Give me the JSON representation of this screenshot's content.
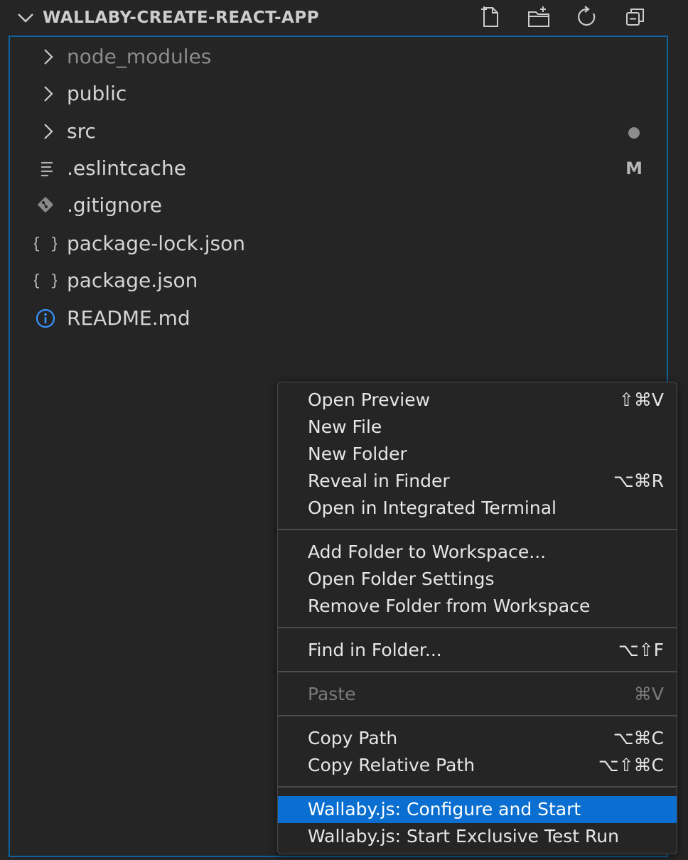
{
  "explorer": {
    "title": "WALLABY-CREATE-REACT-APP",
    "actions": [
      {
        "name": "new-file-icon"
      },
      {
        "name": "new-folder-icon"
      },
      {
        "name": "refresh-icon"
      },
      {
        "name": "collapse-all-icon"
      }
    ],
    "items": [
      {
        "label": "node_modules",
        "type": "folder",
        "dim": true
      },
      {
        "label": "public",
        "type": "folder"
      },
      {
        "label": "src",
        "type": "folder",
        "decoration": "dot"
      },
      {
        "label": ".eslintcache",
        "type": "file-lines",
        "decoration": "M"
      },
      {
        "label": ".gitignore",
        "type": "git"
      },
      {
        "label": "package-lock.json",
        "type": "json"
      },
      {
        "label": "package.json",
        "type": "json"
      },
      {
        "label": "README.md",
        "type": "info"
      }
    ]
  },
  "context_menu": {
    "groups": [
      [
        {
          "label": "Open Preview",
          "shortcut": "⇧⌘V"
        },
        {
          "label": "New File",
          "shortcut": ""
        },
        {
          "label": "New Folder",
          "shortcut": ""
        },
        {
          "label": "Reveal in Finder",
          "shortcut": "⌥⌘R"
        },
        {
          "label": "Open in Integrated Terminal",
          "shortcut": ""
        }
      ],
      [
        {
          "label": "Add Folder to Workspace...",
          "shortcut": ""
        },
        {
          "label": "Open Folder Settings",
          "shortcut": ""
        },
        {
          "label": "Remove Folder from Workspace",
          "shortcut": ""
        }
      ],
      [
        {
          "label": "Find in Folder...",
          "shortcut": "⌥⇧F"
        }
      ],
      [
        {
          "label": "Paste",
          "shortcut": "⌘V",
          "disabled": true
        }
      ],
      [
        {
          "label": "Copy Path",
          "shortcut": "⌥⌘C"
        },
        {
          "label": "Copy Relative Path",
          "shortcut": "⌥⇧⌘C"
        }
      ],
      [
        {
          "label": "Wallaby.js: Configure and Start",
          "shortcut": "",
          "active": true
        },
        {
          "label": "Wallaby.js: Start Exclusive Test Run",
          "shortcut": ""
        }
      ]
    ]
  },
  "colors": {
    "background": "#252526",
    "focus_border": "#0e639c",
    "menu_highlight": "#0a6fd0",
    "info_icon": "#3794ff"
  }
}
